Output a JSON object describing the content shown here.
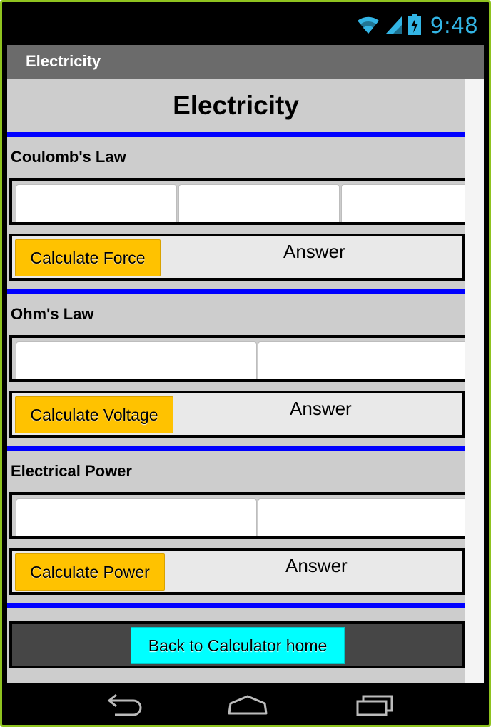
{
  "status_bar": {
    "time": "9:48",
    "icons": [
      "wifi-icon",
      "signal-icon",
      "battery-charging-icon"
    ],
    "accent_color": "#33b5e5"
  },
  "action_bar": {
    "title": "Electricity",
    "background": "#6b6b6b"
  },
  "page": {
    "title": "Electricity",
    "divider_color": "#0000ff",
    "background": "#cdcdcd"
  },
  "sections": [
    {
      "title": "Coulomb's Law",
      "fields": [
        "",
        "",
        ""
      ],
      "button_label": "Calculate Force",
      "answer": "Answer"
    },
    {
      "title": "Ohm's Law",
      "fields": [
        "",
        ""
      ],
      "button_label": "Calculate Voltage",
      "answer": "Answer"
    },
    {
      "title": "Electrical Power",
      "fields": [
        "",
        ""
      ],
      "button_label": "Calculate Power",
      "answer": "Answer"
    }
  ],
  "buttons": {
    "calc_color": "#ffc200",
    "back_color": "#00ffff"
  },
  "back": {
    "label": "Back to Calculator home"
  },
  "nav_bar": {
    "icons": [
      "back-icon",
      "home-icon",
      "recent-apps-icon"
    ]
  }
}
